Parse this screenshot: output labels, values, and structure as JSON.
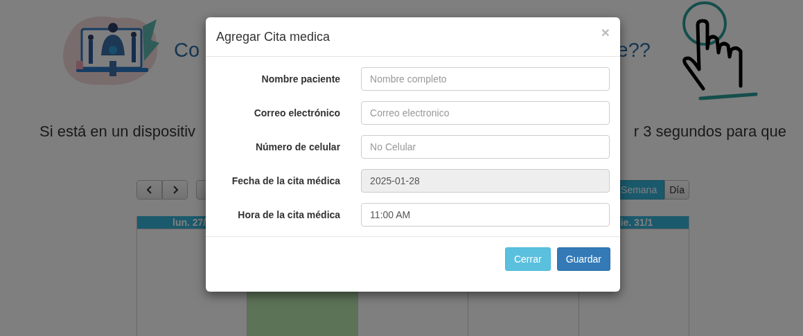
{
  "page": {
    "heading_start": "Co",
    "heading_end": "e??",
    "instruction_start": "Si está en un dispositiv",
    "instruction_end": "r 3 segundos para que"
  },
  "calendar": {
    "views": [
      {
        "label": "Semana",
        "selected": true
      },
      {
        "label": "Día",
        "selected": false
      }
    ],
    "columns": [
      {
        "label": "lun. 27/",
        "today": false
      },
      {
        "today": true
      },
      {
        "today": false
      },
      {
        "today": false
      },
      {
        "label": "ie. 31/1",
        "today": false
      }
    ]
  },
  "modal": {
    "title": "Agregar Cita medica",
    "close": "×",
    "fields": [
      {
        "label": "Nombre paciente",
        "placeholder": "Nombre completo",
        "disabled": false
      },
      {
        "label": "Correo electrónico",
        "placeholder": "Correo electronico",
        "disabled": false
      },
      {
        "label": "Número de celular",
        "placeholder": "No Celular",
        "disabled": false
      },
      {
        "label": "Fecha de la cita médica",
        "value": "2025-01-28",
        "disabled": true
      },
      {
        "label": "Hora de la cita médica",
        "value": "11:00 AM",
        "disabled": false
      }
    ],
    "buttons": [
      {
        "label": "Cerrar",
        "kind": "secondary"
      },
      {
        "label": "Guardar",
        "kind": "primary"
      }
    ]
  }
}
